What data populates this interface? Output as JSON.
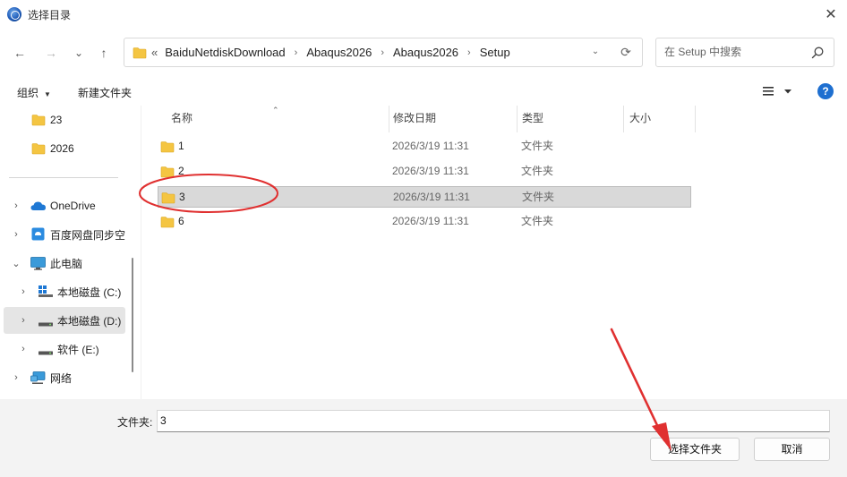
{
  "window": {
    "title": "选择目录",
    "close_glyph": "✕",
    "icon": "app-globe-icon"
  },
  "nav": {
    "back_glyph": "←",
    "forward_glyph": "→",
    "recent_glyph": "⌄",
    "up_glyph": "↑"
  },
  "address": {
    "prefix_glyph": "«",
    "segments": [
      "BaiduNetdiskDownload",
      "Abaqus2026",
      "Abaqus2026",
      "Setup"
    ],
    "separator": "›",
    "dropdown_glyph": "⌄",
    "refresh_glyph": "⟳"
  },
  "search": {
    "placeholder": "在 Setup 中搜索",
    "icon": "search-icon"
  },
  "toolbar": {
    "organize_label": "组织",
    "new_folder_label": "新建文件夹",
    "caret": "▼",
    "view_icon": "list-view-icon",
    "help_glyph": "?"
  },
  "sidebar": {
    "items": [
      {
        "label": "23",
        "icon": "folder-icon"
      },
      {
        "label": "2026",
        "icon": "folder-icon"
      },
      {
        "label": "OneDrive",
        "icon": "cloud-icon"
      },
      {
        "label": "百度网盘同步空",
        "icon": "baidu-sync-icon"
      },
      {
        "label": "此电脑",
        "icon": "computer-icon"
      },
      {
        "label": "本地磁盘 (C:)",
        "icon": "windows-drive-icon"
      },
      {
        "label": "本地磁盘 (D:)",
        "icon": "drive-icon"
      },
      {
        "label": "软件 (E:)",
        "icon": "drive-icon"
      },
      {
        "label": "网络",
        "icon": "network-icon"
      }
    ],
    "chevron_right": "›",
    "chevron_down": "⌄"
  },
  "columns": {
    "name": "名称",
    "date": "修改日期",
    "type": "类型",
    "size": "大小",
    "sort_glyph": "⌃"
  },
  "files": [
    {
      "name": "1",
      "date": "2026/3/19 11:31",
      "type": "文件夹"
    },
    {
      "name": "2",
      "date": "2026/3/19 11:31",
      "type": "文件夹"
    },
    {
      "name": "3",
      "date": "2026/3/19 11:31",
      "type": "文件夹"
    },
    {
      "name": "6",
      "date": "2026/3/19 11:31",
      "type": "文件夹"
    }
  ],
  "footer": {
    "folder_label": "文件夹:",
    "folder_value": "3",
    "select_button": "选择文件夹",
    "cancel_button": "取消"
  },
  "colors": {
    "annotation_red": "#e03030",
    "selection": "#d9d9d9",
    "folder_yellow": "#f4c542"
  }
}
